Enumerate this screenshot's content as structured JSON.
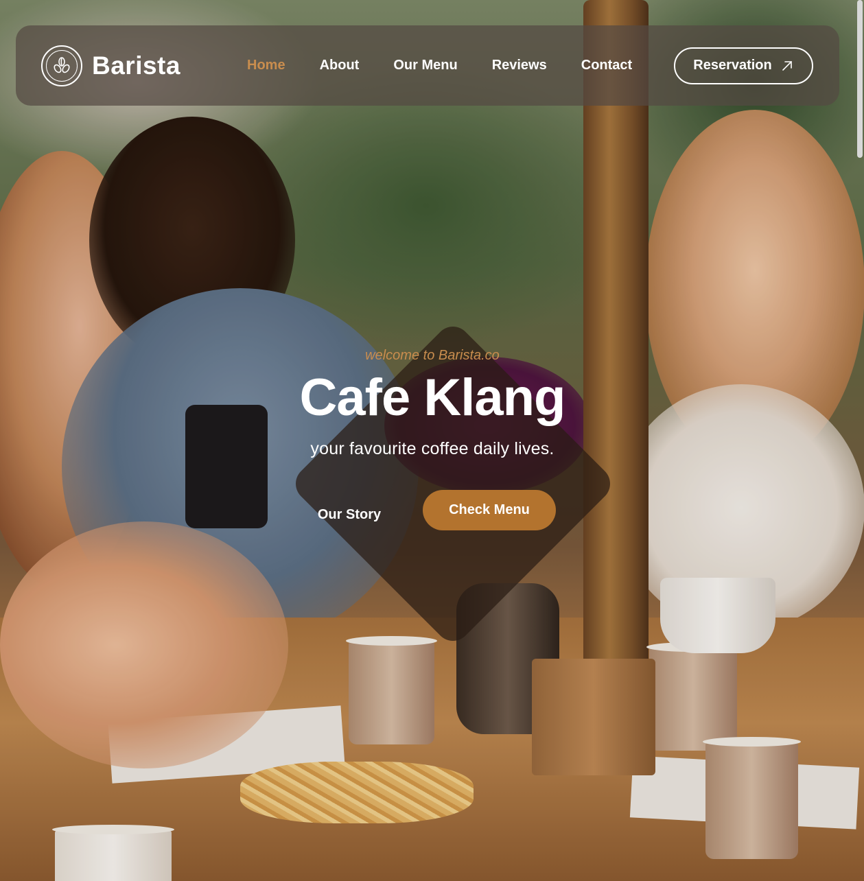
{
  "brand": {
    "name": "Barista",
    "logo_icon": "coffee-beans-icon"
  },
  "nav": {
    "items": [
      {
        "label": "Home",
        "active": true
      },
      {
        "label": "About",
        "active": false
      },
      {
        "label": "Our Menu",
        "active": false
      },
      {
        "label": "Reviews",
        "active": false
      },
      {
        "label": "Contact",
        "active": false
      }
    ],
    "reservation_label": "Reservation",
    "reservation_icon": "arrow-up-right-icon"
  },
  "hero": {
    "welcome": "welcome to Barista.co",
    "title": "Cafe Klang",
    "subtitle": "your favourite coffee daily lives.",
    "story_button": "Our Story",
    "menu_button": "Check Menu"
  },
  "colors": {
    "accent": "#c98d4e",
    "button": "#b3732e",
    "header_bg": "#554a42"
  }
}
